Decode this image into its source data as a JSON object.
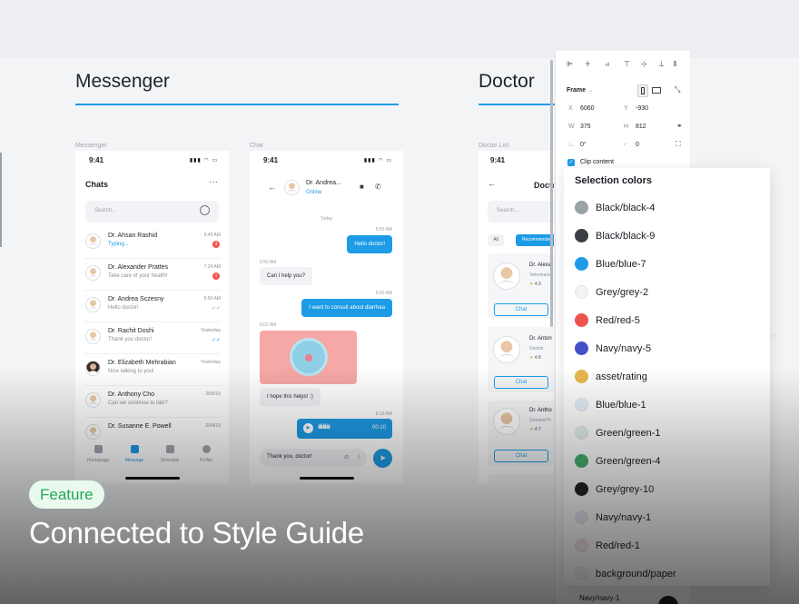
{
  "sections": {
    "messenger": "Messenger",
    "doctor": "Doctor"
  },
  "frame_labels": {
    "messenger": "Messenger",
    "chat": "Chat",
    "doctor_list": "Doctor List"
  },
  "status_time": "9:41",
  "messenger": {
    "title": "Chats",
    "search_placeholder": "Search...",
    "chats": [
      {
        "name": "Dr. Ahsan Rashid",
        "message": "Typing...",
        "time": "9:45 AM",
        "badge": "3"
      },
      {
        "name": "Dr. Alexander Prattes",
        "message": "Take care of your health!",
        "time": "7:24 AM",
        "badge": "1"
      },
      {
        "name": "Dr. Andrea Sczesny",
        "message": "Hello doctor!",
        "time": "5:50 AM"
      },
      {
        "name": "Dr. Rachit Doshi",
        "message": "Thank you doctor!",
        "time": "Yesterday"
      },
      {
        "name": "Dr. Elizabeth Mehrabian",
        "message": "Nice talking to you!",
        "time": "Yesterday"
      },
      {
        "name": "Dr. Anthony Cho",
        "message": "Can we continue to talk?",
        "time": "25/6/19"
      },
      {
        "name": "Dr. Susanne E. Powell",
        "message": "",
        "time": "20/4/19"
      }
    ],
    "tabs": [
      "Homepage",
      "Message",
      "Schedule",
      "Profile"
    ]
  },
  "chat": {
    "contact_name": "Dr. Andrea...",
    "contact_status": "Online",
    "date": "Today",
    "messages": [
      {
        "time": "5:50 AM",
        "text": "Hello doctor!"
      },
      {
        "time": "5:50 AM",
        "text": "Can I help you?"
      },
      {
        "time": "6:00 AM",
        "text": "I want to consult about diarrhea"
      },
      {
        "time": "6:02 AM",
        "text": ""
      },
      {
        "time": "",
        "text": "I hope this helps! :)"
      },
      {
        "time": "6:10 AM",
        "text": ""
      }
    ],
    "voice_duration": "00:10",
    "input_value": "Thank you, doctor!"
  },
  "doctor": {
    "title": "Docto",
    "search_placeholder": "Search...",
    "filters": [
      "All",
      "Recommended"
    ],
    "cards": [
      {
        "name": "Dr. Alexa",
        "specialty": "Veterinaria",
        "rating": "4.9"
      },
      {
        "name": "Dr. Anton",
        "specialty": "Dentist",
        "rating": "4.8"
      },
      {
        "name": "Dr. Antho",
        "specialty": "General Pr",
        "rating": "4.7"
      }
    ],
    "chat_button": "Chat"
  },
  "properties": {
    "frame_label": "Frame",
    "x_label": "X",
    "x_value": "6060",
    "y_label": "Y",
    "y_value": "-930",
    "w_label": "W",
    "w_value": "375",
    "h_label": "H",
    "h_value": "812",
    "rotation": "0°",
    "radius": "0",
    "clip_content": "Clip content"
  },
  "selection_colors": {
    "title": "Selection colors",
    "items": [
      {
        "name": "Black/black-4",
        "color": "#9aa3a6"
      },
      {
        "name": "Black/black-9",
        "color": "#3b3f45"
      },
      {
        "name": "Blue/blue-7",
        "color": "#1d9be6"
      },
      {
        "name": "Grey/grey-2",
        "color": "#f4f4f4"
      },
      {
        "name": "Red/red-5",
        "color": "#ef5350"
      },
      {
        "name": "Navy/navy-5",
        "color": "#4450c8"
      },
      {
        "name": "asset/rating",
        "color": "#e7b74f"
      },
      {
        "name": "Blue/blue-1",
        "color": "#e3f0fa"
      },
      {
        "name": "Green/green-1",
        "color": "#e3f2ea"
      },
      {
        "name": "Green/green-4",
        "color": "#46b070"
      },
      {
        "name": "Grey/grey-10",
        "color": "#262626"
      },
      {
        "name": "Navy/navy-1",
        "color": "#e8e8f5"
      },
      {
        "name": "Red/red-1",
        "color": "#f7e6e6"
      },
      {
        "name": "background/paper",
        "color": "#f7f7f7"
      }
    ],
    "extra": "Navy/navy-1"
  },
  "feature_tag": "Feature",
  "headline": "Connected to Style Guide",
  "clipped_text": "n"
}
